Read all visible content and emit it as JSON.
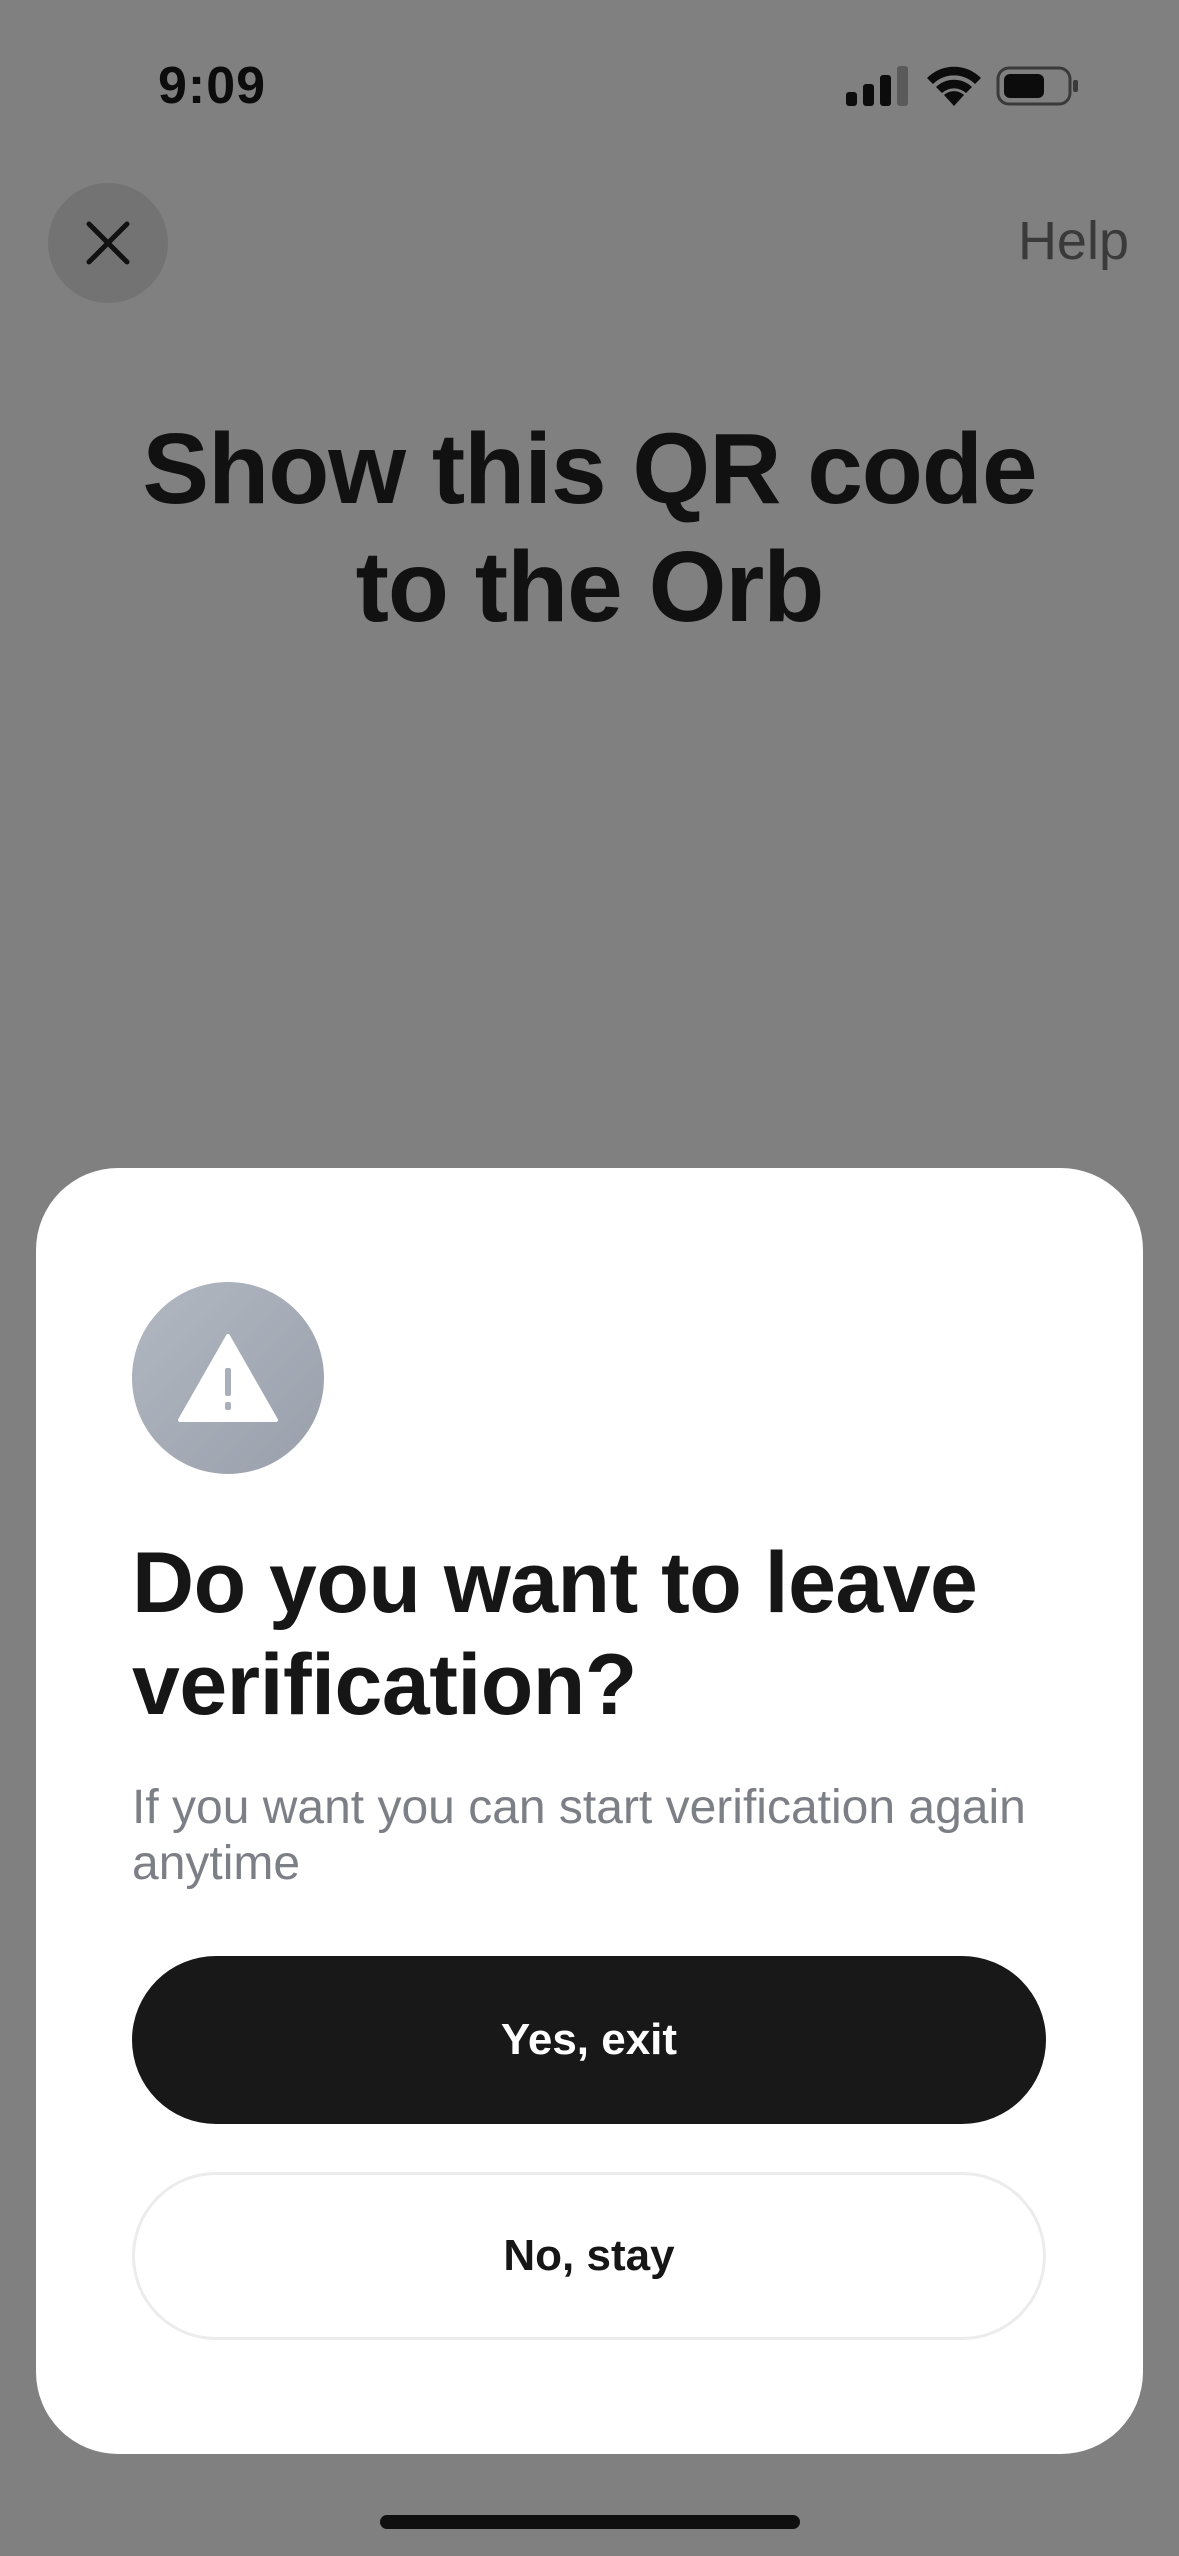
{
  "status_bar": {
    "time": "9:09",
    "icons": [
      "cellular-signal-icon",
      "wifi-icon",
      "battery-icon"
    ]
  },
  "nav": {
    "close_icon": "close-icon",
    "help_label": "Help"
  },
  "page": {
    "title_line1": "Show this QR code",
    "title_line2": "to the Orb"
  },
  "dialog": {
    "icon": "warning-triangle-icon",
    "title": "Do you want to leave verification?",
    "subtitle": "If you want you can start verification again anytime",
    "primary_label": "Yes, exit",
    "secondary_label": "No, stay"
  },
  "colors": {
    "overlay": "#808080",
    "sheet_bg": "#ffffff",
    "primary_button": "#181818",
    "badge_gray": "#a5abb5"
  }
}
